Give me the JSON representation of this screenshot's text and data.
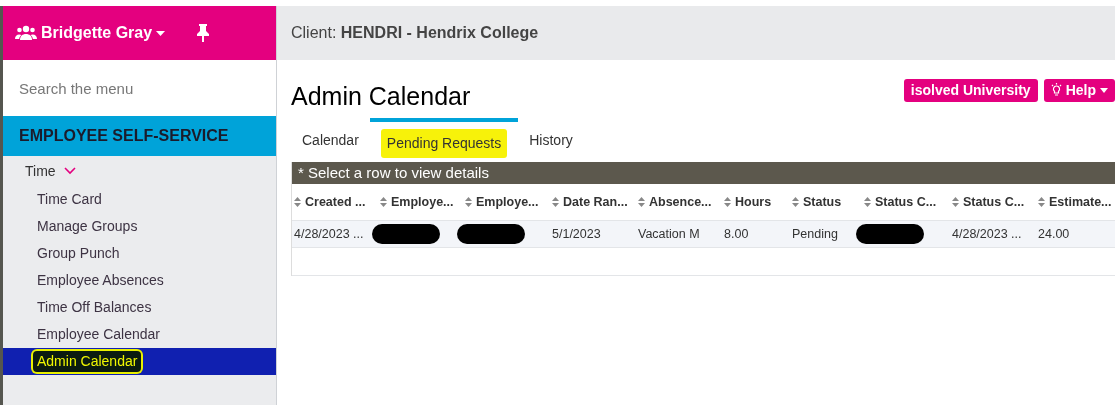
{
  "user_menu": {
    "name": "Bridgette Gray"
  },
  "client_bar": {
    "label": "Client:",
    "client": "HENDRI - Hendrix College"
  },
  "sidebar": {
    "search": {
      "placeholder": "Search the menu"
    },
    "section": "EMPLOYEE SELF-SERVICE",
    "group": {
      "label": "Time",
      "expanded": true,
      "items": [
        {
          "label": "Time Card",
          "selected": false,
          "highlighted": false
        },
        {
          "label": "Manage Groups",
          "selected": false,
          "highlighted": false
        },
        {
          "label": "Group Punch",
          "selected": false,
          "highlighted": false
        },
        {
          "label": "Employee Absences",
          "selected": false,
          "highlighted": false
        },
        {
          "label": "Time Off Balances",
          "selected": false,
          "highlighted": false
        },
        {
          "label": "Employee Calendar",
          "selected": false,
          "highlighted": false
        },
        {
          "label": "Admin Calendar",
          "selected": true,
          "highlighted": true
        }
      ]
    }
  },
  "page": {
    "title": "Admin Calendar",
    "buttons": [
      {
        "label": "isolved University",
        "kind": "plain"
      },
      {
        "label": "Help",
        "kind": "help"
      }
    ],
    "tabs": [
      {
        "label": "Calendar",
        "selected": false,
        "highlighted": false
      },
      {
        "label": "Pending Requests",
        "selected": true,
        "highlighted": true
      },
      {
        "label": "History",
        "selected": false,
        "highlighted": false
      }
    ]
  },
  "table": {
    "caption": "* Select a row to view details",
    "columns": [
      "Created ...",
      "Employe...",
      "Employe...",
      "Date Ran...",
      "Absence...",
      "Hours",
      "Status",
      "Status C...",
      "Status C...",
      "Estimate..."
    ],
    "rows": [
      [
        {
          "text": "4/28/2023 ..."
        },
        {
          "redacted": true
        },
        {
          "redacted": true
        },
        {
          "text": "5/1/2023"
        },
        {
          "text": "Vacation M"
        },
        {
          "text": "8.00"
        },
        {
          "text": "Pending"
        },
        {
          "redacted": true
        },
        {
          "text": "4/28/2023 ..."
        },
        {
          "text": "24.00"
        }
      ]
    ]
  }
}
